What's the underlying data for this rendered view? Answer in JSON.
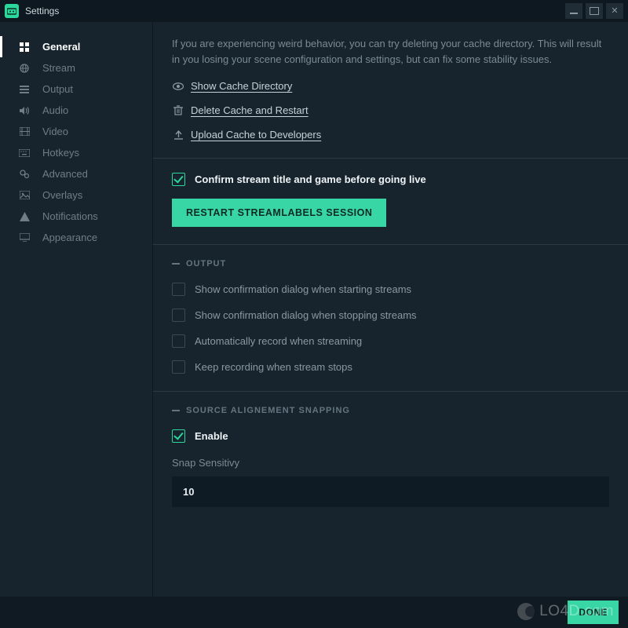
{
  "window": {
    "title": "Settings"
  },
  "sidebar": {
    "items": [
      {
        "label": "General",
        "icon": "grid-icon",
        "active": true
      },
      {
        "label": "Stream",
        "icon": "globe-icon",
        "active": false
      },
      {
        "label": "Output",
        "icon": "bars-icon",
        "active": false
      },
      {
        "label": "Audio",
        "icon": "speaker-icon",
        "active": false
      },
      {
        "label": "Video",
        "icon": "film-icon",
        "active": false
      },
      {
        "label": "Hotkeys",
        "icon": "keyboard-icon",
        "active": false
      },
      {
        "label": "Advanced",
        "icon": "cogs-icon",
        "active": false
      },
      {
        "label": "Overlays",
        "icon": "image-icon",
        "active": false
      },
      {
        "label": "Notifications",
        "icon": "warning-icon",
        "active": false
      },
      {
        "label": "Appearance",
        "icon": "monitor-icon",
        "active": false
      }
    ]
  },
  "main": {
    "cache": {
      "description": "If you are experiencing weird behavior, you can try deleting your cache directory. This will result in you losing your scene configuration and settings, but can fix some stability issues.",
      "show_link": "Show Cache Directory",
      "delete_link": "Delete Cache and Restart",
      "upload_link": "Upload Cache to Developers"
    },
    "confirm": {
      "label": "Confirm stream title and game before going live",
      "checked": true,
      "restart_button": "RESTART STREAMLABELS SESSION"
    },
    "output": {
      "header": "OUTPUT",
      "options": [
        {
          "label": "Show confirmation dialog when starting streams",
          "checked": false
        },
        {
          "label": "Show confirmation dialog when stopping streams",
          "checked": false
        },
        {
          "label": "Automatically record when streaming",
          "checked": false
        },
        {
          "label": "Keep recording when stream stops",
          "checked": false
        }
      ]
    },
    "snapping": {
      "header": "SOURCE ALIGNEMENT SNAPPING",
      "enable_label": "Enable",
      "enable_checked": true,
      "sensitivity_label": "Snap Sensitivy",
      "sensitivity_value": "10"
    }
  },
  "footer": {
    "done": "DONE"
  },
  "watermark": "LO4D.com",
  "colors": {
    "accent": "#39d6a5",
    "bg": "#17242d",
    "panel": "#0f1b24"
  }
}
